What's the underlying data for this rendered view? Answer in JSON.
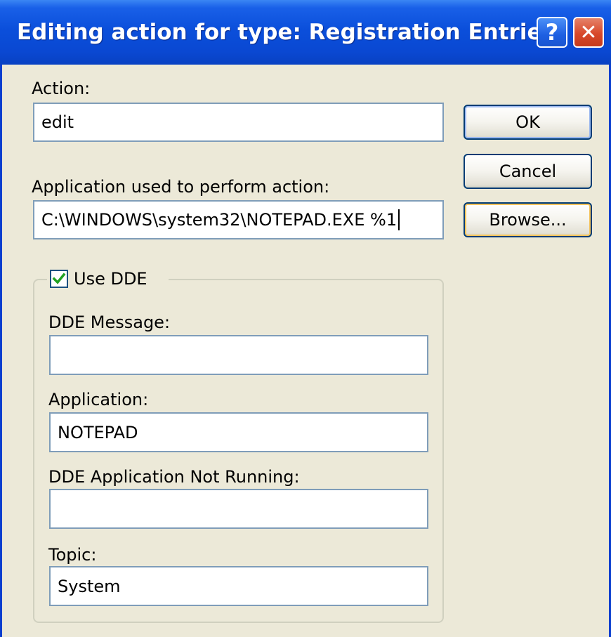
{
  "window": {
    "title": "Editing action for type: Registration Entries",
    "help_glyph": "?",
    "close_glyph": "✕"
  },
  "action": {
    "label": "Action:",
    "value": "edit"
  },
  "application": {
    "label": "Application used to perform action:",
    "value": "C:\\WINDOWS\\system32\\NOTEPAD.EXE %1"
  },
  "buttons": {
    "ok": "OK",
    "cancel": "Cancel",
    "browse": "Browse..."
  },
  "dde": {
    "checkbox_label": "Use DDE",
    "checked": true,
    "message_label": "DDE Message:",
    "message_value": "",
    "app_label": "Application:",
    "app_value": "NOTEPAD",
    "not_running_label": "DDE Application Not Running:",
    "not_running_value": "",
    "topic_label": "Topic:",
    "topic_value": "System"
  },
  "colors": {
    "title_bar": "#0b4fdb",
    "dialog_bg": "#ece9d8",
    "field_border": "#7f9db9",
    "check_mark": "#21a121"
  }
}
